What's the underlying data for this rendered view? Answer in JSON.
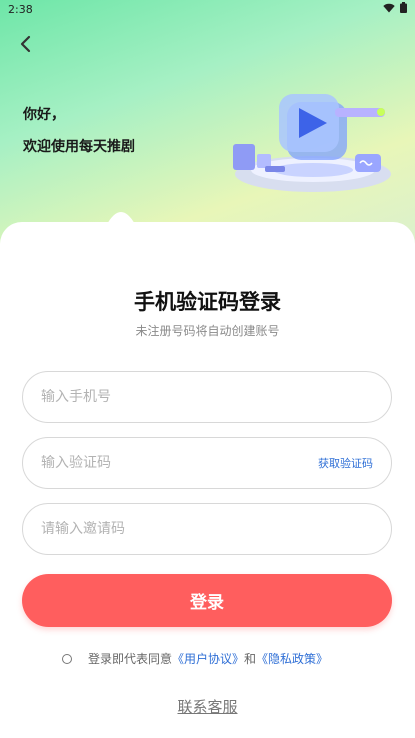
{
  "statusbar": {
    "time": "2:38",
    "icons": [
      "wifi-icon",
      "battery-icon"
    ]
  },
  "header": {
    "back_icon": "chevron-left-icon",
    "greeting_line1": "你好，",
    "greeting_line2": "欢迎使用每天推剧"
  },
  "login": {
    "title": "手机验证码登录",
    "subtitle": "未注册号码将自动创建账号",
    "phone_placeholder": "输入手机号",
    "code_placeholder": "输入验证码",
    "get_code_label": "获取验证码",
    "invite_placeholder": "请输入邀请码",
    "submit_label": "登录"
  },
  "agreement": {
    "prefix": "登录即代表同意",
    "user_agreement": "《用户协议》",
    "conjunction": "和",
    "privacy_policy": "《隐私政策》"
  },
  "footer": {
    "contact_label": "联系客服"
  },
  "colors": {
    "accent": "#ff5e5e",
    "link": "#2f6fd6",
    "hero_start": "#6ee6a8",
    "hero_end": "#e8f6b8"
  }
}
